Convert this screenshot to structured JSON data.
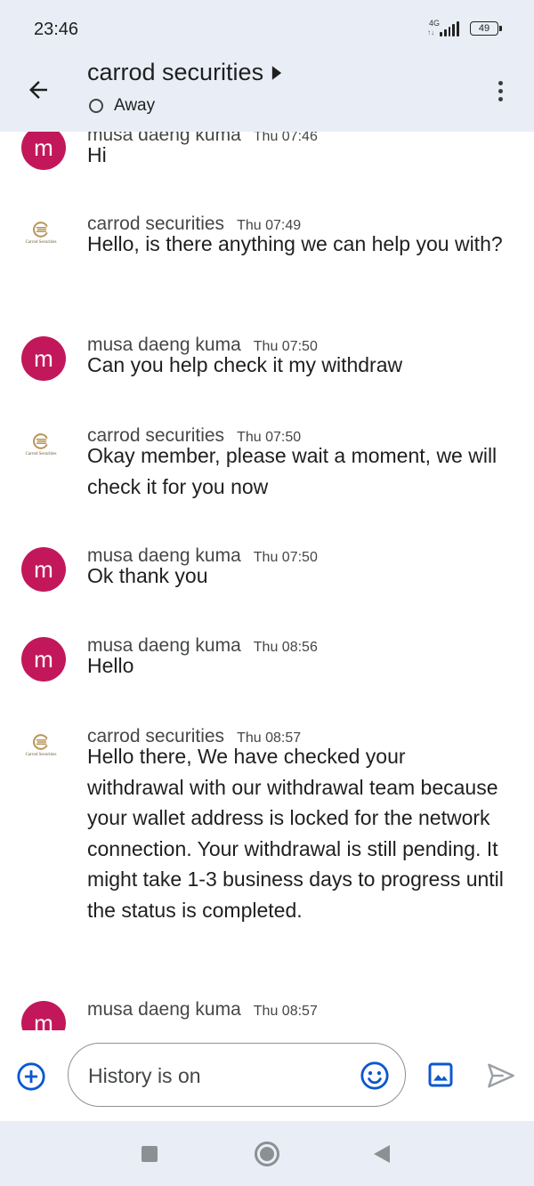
{
  "status_bar": {
    "time": "23:46",
    "network_label": "4G",
    "network_sub": "↑↓",
    "battery": "49"
  },
  "header": {
    "title": "carrod securities",
    "status": "Away",
    "icons": {
      "back": "arrow-left-icon",
      "menu": "more-vert-icon",
      "title_chevron": "play-arrow-icon",
      "status": "away-ring-icon"
    }
  },
  "messages": [
    {
      "sender": "musa daeng kuma",
      "avatar_letter": "m",
      "avatar_type": "letter",
      "time": "Thu 07:46",
      "text": "Hi"
    },
    {
      "sender": "carrod securities",
      "avatar_type": "logo",
      "logo_text": "Carrod Securities",
      "time": "Thu 07:49",
      "text": "Hello, is there anything we can help you with?"
    },
    {
      "sender": "musa daeng kuma",
      "avatar_letter": "m",
      "avatar_type": "letter",
      "time": "Thu 07:50",
      "text": "Can you help check it my withdraw"
    },
    {
      "sender": "carrod securities",
      "avatar_type": "logo",
      "logo_text": "Carrod Securities",
      "time": "Thu 07:50",
      "text": "Okay member, please wait a moment, we will check it for you now"
    },
    {
      "sender": "musa daeng kuma",
      "avatar_letter": "m",
      "avatar_type": "letter",
      "time": "Thu 07:50",
      "text": "Ok thank you"
    },
    {
      "sender": "musa daeng kuma",
      "avatar_letter": "m",
      "avatar_type": "letter",
      "time": "Thu 08:56",
      "text": "Hello"
    },
    {
      "sender": "carrod securities",
      "avatar_type": "logo",
      "logo_text": "Carrod Securities",
      "time": "Thu 08:57",
      "text": "Hello there, We have checked your withdrawal with our withdrawal team because your wallet address is locked for the network connection. Your withdrawal is still pending. It might take 1-3 business days to progress until the status is completed."
    },
    {
      "sender": "musa daeng kuma",
      "avatar_letter": "m",
      "avatar_type": "letter",
      "time": "Thu 08:57",
      "text": ""
    }
  ],
  "composer": {
    "placeholder": "History is on",
    "icons": {
      "add": "add-circle-icon",
      "emoji": "emoji-icon",
      "image": "image-icon",
      "send": "send-icon"
    }
  },
  "colors": {
    "header_bg": "#e9eef6",
    "avatar_bg": "#c2185b",
    "accent": "#0b57d0",
    "logo_gold": "#b8955a"
  }
}
